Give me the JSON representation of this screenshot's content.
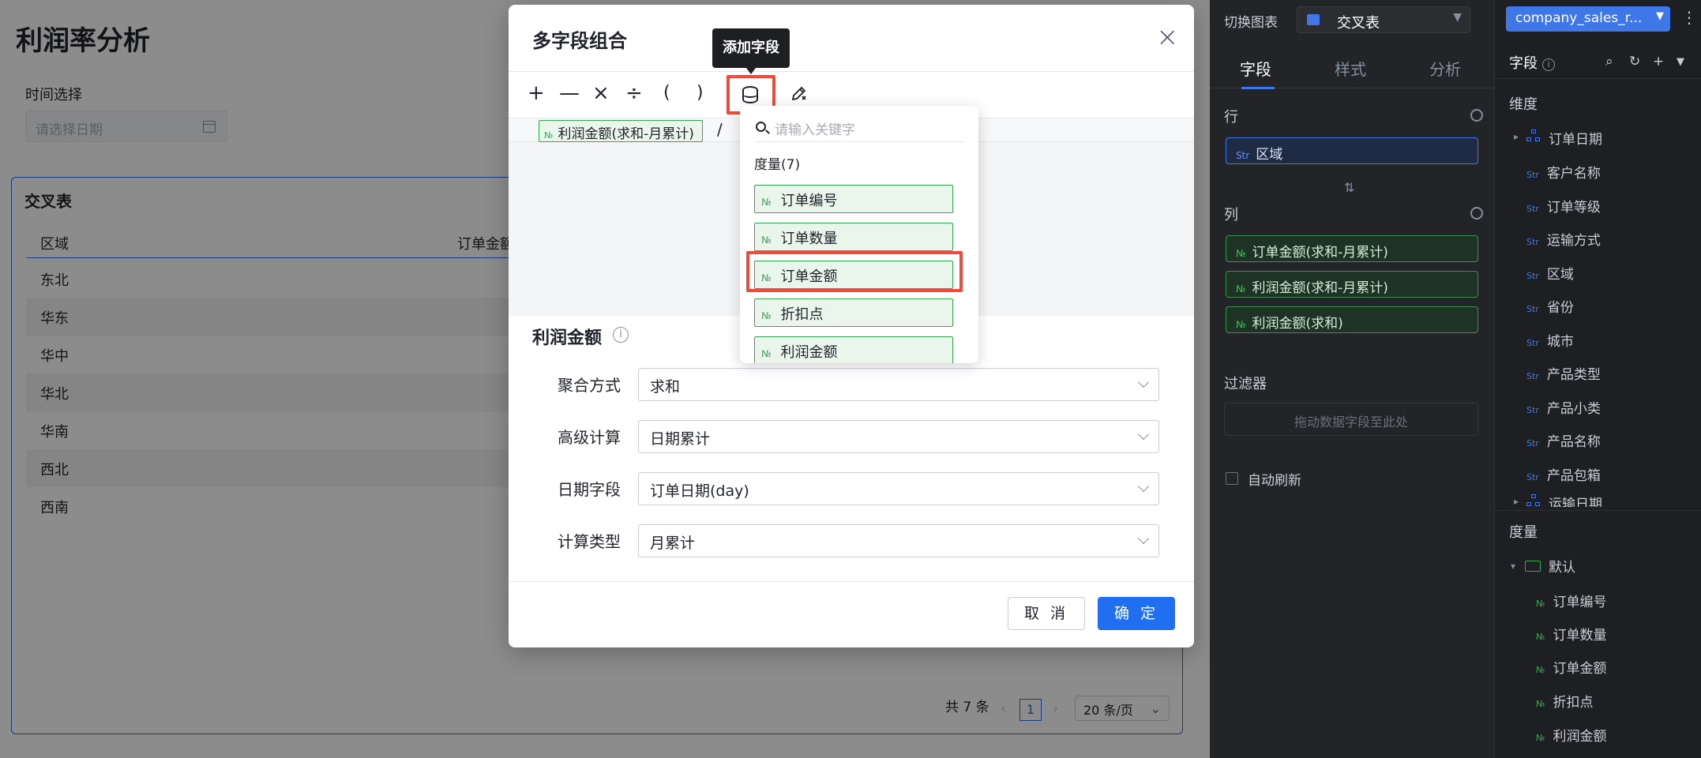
{
  "page": {
    "title": "利润率分析",
    "time_label": "时间选择",
    "date_placeholder": "请选择日期"
  },
  "table_card": {
    "title": "交叉表",
    "columns": [
      "区域",
      "订单金额_"
    ],
    "rows": [
      "东北",
      "华东",
      "华中",
      "华北",
      "华南",
      "西北",
      "西南"
    ],
    "pagination": {
      "total": "共 7 条",
      "current_page": "1",
      "page_size": "20 条/页"
    }
  },
  "config_panel": {
    "switch_chart_label": "切换图表",
    "chart_type": "交叉表",
    "tabs": [
      "字段",
      "样式",
      "分析"
    ],
    "active_tab": "字段",
    "rows_label": "行",
    "rows": [
      {
        "tag": "Str",
        "label": "区域"
      }
    ],
    "columns_label": "列",
    "columns": [
      {
        "tag": "№",
        "label": "订单金额(求和-月累计)"
      },
      {
        "tag": "№",
        "label": "利润金额(求和-月累计)"
      },
      {
        "tag": "№",
        "label": "利润金额(求和)"
      }
    ],
    "filter_label": "过滤器",
    "filter_placeholder": "拖动数据字段至此处",
    "auto_refresh_label": "自动刷新"
  },
  "field_list": {
    "dataset": "company_sales_r...",
    "title": "字段",
    "info": "i",
    "dimension_title": "维度",
    "dimensions": [
      {
        "tag": "",
        "label": "订单日期",
        "hierarchy": true
      },
      {
        "tag": "Str",
        "label": "客户名称"
      },
      {
        "tag": "Str",
        "label": "订单等级"
      },
      {
        "tag": "Str",
        "label": "运输方式"
      },
      {
        "tag": "Str",
        "label": "区域"
      },
      {
        "tag": "Str",
        "label": "省份"
      },
      {
        "tag": "Str",
        "label": "城市"
      },
      {
        "tag": "Str",
        "label": "产品类型"
      },
      {
        "tag": "Str",
        "label": "产品小类"
      },
      {
        "tag": "Str",
        "label": "产品名称"
      },
      {
        "tag": "Str",
        "label": "产品包箱"
      },
      {
        "tag": "",
        "label": "运输日期",
        "hierarchy": true
      }
    ],
    "measure_title": "度量",
    "measure_folder": "默认",
    "measures": [
      {
        "tag": "№",
        "label": "订单编号"
      },
      {
        "tag": "№",
        "label": "订单数量"
      },
      {
        "tag": "№",
        "label": "订单金额"
      },
      {
        "tag": "№",
        "label": "折扣点"
      },
      {
        "tag": "№",
        "label": "利润金额"
      }
    ]
  },
  "modal": {
    "title": "多字段组合",
    "tooltip": "添加字段",
    "operators": [
      "+",
      "—",
      "×",
      "÷",
      "(",
      ")"
    ],
    "formula": {
      "token_tag": "№",
      "token_label": "利润金额(求和-月累计)",
      "operator": "/"
    },
    "dropdown": {
      "search_placeholder": "请输入关键字",
      "group_label": "度量(7)",
      "items": [
        {
          "tag": "№",
          "label": "订单编号"
        },
        {
          "tag": "№",
          "label": "订单数量"
        },
        {
          "tag": "№",
          "label": "订单金额"
        },
        {
          "tag": "№",
          "label": "折扣点"
        },
        {
          "tag": "№",
          "label": "利润金额"
        }
      ]
    },
    "measure_title": "利润金额",
    "form": [
      {
        "label": "聚合方式",
        "value": "求和"
      },
      {
        "label": "高级计算",
        "value": "日期累计"
      },
      {
        "label": "日期字段",
        "value": "订单日期(day)"
      },
      {
        "label": "计算类型",
        "value": "月累计"
      }
    ],
    "cancel_label": "取 消",
    "ok_label": "确 定"
  },
  "colors": {
    "accent": "#1f6ff0",
    "highlight": "#f04a3a",
    "measure_green": "#34a853",
    "dimension_blue": "#3f77e8"
  }
}
